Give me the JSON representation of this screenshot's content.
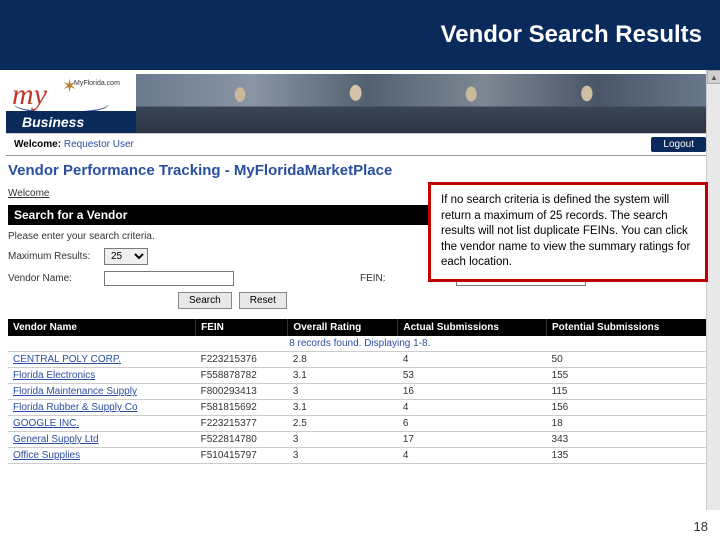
{
  "slide": {
    "title": "Vendor Search Results",
    "page_number": "18"
  },
  "header": {
    "logo_text": "my",
    "logo_sub": "MyFlorida.com",
    "business_label": "Business"
  },
  "welcome_bar": {
    "label": "Welcome:",
    "user": "Requestor User",
    "logout": "Logout"
  },
  "page": {
    "title": "Vendor Performance Tracking - MyFloridaMarketPlace",
    "welcome_link": "Welcome"
  },
  "search": {
    "header": "Search for a Vendor",
    "instructions": "Please enter your search criteria.",
    "max_results_label": "Maximum Results:",
    "max_results_value": "25",
    "vendor_name_label": "Vendor Name:",
    "vendor_name_value": "",
    "fein_label": "FEIN:",
    "fein_value": "",
    "search_btn": "Search",
    "reset_btn": "Reset"
  },
  "callout": {
    "text": "If no search criteria is defined the system will return a maximum of 25 records. The search results will not list duplicate FEINs. You can click the vendor name to view the summary ratings for each location."
  },
  "results": {
    "count_text": "8 records found. Displaying 1-8.",
    "columns": [
      "Vendor Name",
      "FEIN",
      "Overall Rating",
      "Actual Submissions",
      "Potential Submissions"
    ],
    "rows": [
      {
        "name": "CENTRAL POLY CORP.",
        "fein": "F223215376",
        "rating": "2.8",
        "actual": "4",
        "potential": "50"
      },
      {
        "name": "Florida Electronics",
        "fein": "F558878782",
        "rating": "3.1",
        "actual": "53",
        "potential": "155"
      },
      {
        "name": "Florida Maintenance Supply",
        "fein": "F800293413",
        "rating": "3",
        "actual": "16",
        "potential": "115"
      },
      {
        "name": "Florida Rubber & Supply Co",
        "fein": "F581815692",
        "rating": "3.1",
        "actual": "4",
        "potential": "156"
      },
      {
        "name": "GOOGLE INC.",
        "fein": "F223215377",
        "rating": "2.5",
        "actual": "6",
        "potential": "18"
      },
      {
        "name": "General Supply Ltd",
        "fein": "F522814780",
        "rating": "3",
        "actual": "17",
        "potential": "343"
      },
      {
        "name": "Office Supplies",
        "fein": "F510415797",
        "rating": "3",
        "actual": "4",
        "potential": "135"
      }
    ]
  }
}
